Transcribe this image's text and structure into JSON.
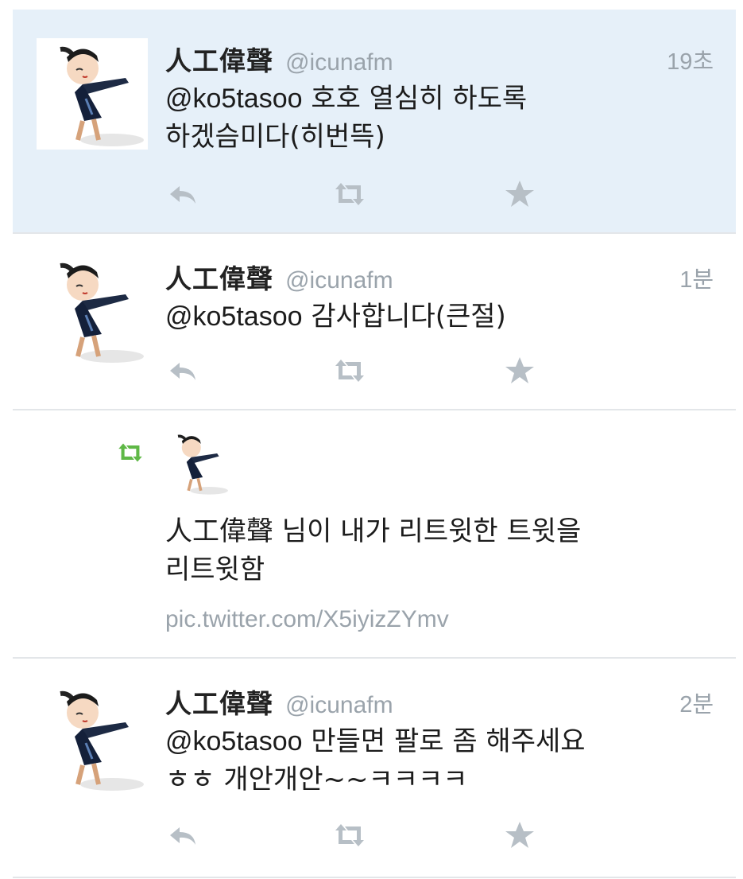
{
  "colors": {
    "highlight_bg": "#e6f0f9",
    "divider": "#e3e6e9",
    "muted": "#9aa3ab",
    "retweet_green": "#5fb846",
    "action_gray": "#b7bfc6"
  },
  "tweets": [
    {
      "name": "人工偉聲",
      "handle": "@icunafm",
      "time": "19초",
      "mention": "@ko5tasoo",
      "text_line1": " 호호 열심히 하도록",
      "text_line2": "하겠슴미다(히번뜩)",
      "actions": [
        "reply-icon",
        "retweet-icon",
        "favorite-icon"
      ]
    },
    {
      "name": "人工偉聲",
      "handle": "@icunafm",
      "time": "1분",
      "mention": "@ko5tasoo",
      "text_line1": " 감사합니다(큰절)",
      "actions": [
        "reply-icon",
        "retweet-icon",
        "favorite-icon"
      ]
    },
    {
      "notification_line1": "人工偉聲 님이 내가 리트윗한 트윗을",
      "notification_line2": "리트윗함",
      "link": "pic.twitter.com/X5iyizZYmv",
      "icon": "retweet-icon"
    },
    {
      "name": "人工偉聲",
      "handle": "@icunafm",
      "time": "2분",
      "mention": "@ko5tasoo",
      "text_line1": " 만들면 팔로 좀 해주세요",
      "text_line2": "ㅎㅎ 개안개안~~ㅋㅋㅋㅋ",
      "actions": [
        "reply-icon",
        "retweet-icon",
        "favorite-icon"
      ]
    }
  ]
}
